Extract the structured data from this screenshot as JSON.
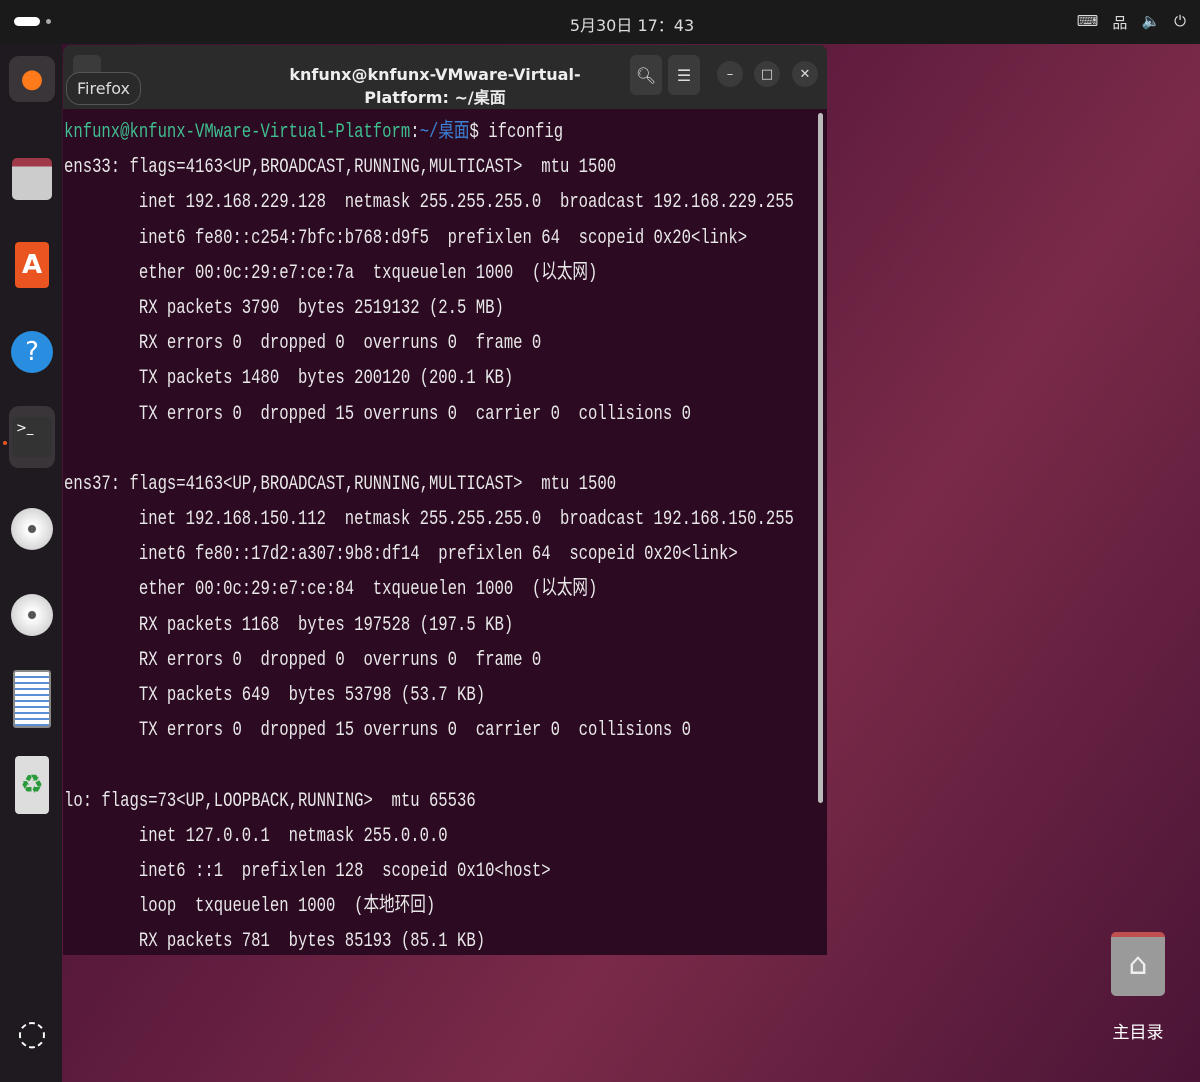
{
  "topbar": {
    "clock": "5月30日 17：43",
    "tray_icons": [
      "keyboard-icon",
      "network-icon",
      "volume-icon",
      "power-icon"
    ]
  },
  "dock": {
    "tooltip": "Firefox",
    "items": [
      "firefox",
      "files",
      "app-center",
      "help",
      "terminal",
      "disc-1",
      "disc-2",
      "text-editor",
      "trash"
    ]
  },
  "terminal": {
    "title": "knfunx@knfunx-VMware-Virtual-Platform: ~/桌面",
    "prompt_user": "knfunx@knfunx-VMware-Virtual-Platform",
    "prompt_sep": ":",
    "prompt_path": "~/桌面",
    "prompt_cmd": "$ ifconfig",
    "lines": [
      "ens33: flags=4163<UP,BROADCAST,RUNNING,MULTICAST>  mtu 1500",
      "        inet 192.168.229.128  netmask 255.255.255.0  broadcast 192.168.229.255",
      "        inet6 fe80::c254:7bfc:b768:d9f5  prefixlen 64  scopeid 0x20<link>",
      "        ether 00:0c:29:e7:ce:7a  txqueuelen 1000  (以太网)",
      "        RX packets 3790  bytes 2519132 (2.5 MB)",
      "        RX errors 0  dropped 0  overruns 0  frame 0",
      "        TX packets 1480  bytes 200120 (200.1 KB)",
      "        TX errors 0  dropped 15 overruns 0  carrier 0  collisions 0",
      "",
      "ens37: flags=4163<UP,BROADCAST,RUNNING,MULTICAST>  mtu 1500",
      "        inet 192.168.150.112  netmask 255.255.255.0  broadcast 192.168.150.255",
      "        inet6 fe80::17d2:a307:9b8:df14  prefixlen 64  scopeid 0x20<link>",
      "        ether 00:0c:29:e7:ce:84  txqueuelen 1000  (以太网)",
      "        RX packets 1168  bytes 197528 (197.5 KB)",
      "        RX errors 0  dropped 0  overruns 0  frame 0",
      "        TX packets 649  bytes 53798 (53.7 KB)",
      "        TX errors 0  dropped 15 overruns 0  carrier 0  collisions 0",
      "",
      "lo: flags=73<UP,LOOPBACK,RUNNING>  mtu 65536",
      "        inet 127.0.0.1  netmask 255.0.0.0",
      "        inet6 ::1  prefixlen 128  scopeid 0x10<host>",
      "        loop  txqueuelen 1000  (本地环回)",
      "        RX packets 781  bytes 85193 (85.1 KB)"
    ]
  },
  "desktop": {
    "home_label": "主目录"
  }
}
